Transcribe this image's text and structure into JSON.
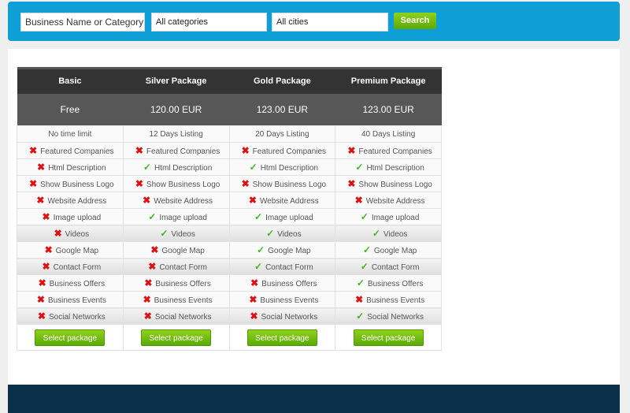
{
  "search": {
    "query_placeholder": "Business Name or Category",
    "category": "All categories",
    "city": "All cities",
    "button": "Search"
  },
  "packages": [
    {
      "name": "Basic",
      "price": "Free",
      "duration": "No time limit",
      "features": [
        false,
        false,
        false,
        false,
        false,
        false,
        false,
        false,
        false,
        false,
        false
      ]
    },
    {
      "name": "Silver Package",
      "price": "120.00 EUR",
      "duration": "12 Days Listing",
      "features": [
        false,
        true,
        false,
        false,
        true,
        true,
        false,
        false,
        false,
        false,
        false
      ]
    },
    {
      "name": "Gold Package",
      "price": "123.00 EUR",
      "duration": "20 Days Listing",
      "features": [
        false,
        true,
        false,
        false,
        true,
        true,
        true,
        true,
        false,
        false,
        false
      ]
    },
    {
      "name": "Premium Package",
      "price": "123.00 EUR",
      "duration": "40 Days Listing",
      "features": [
        false,
        true,
        false,
        false,
        true,
        true,
        true,
        true,
        true,
        false,
        true
      ]
    }
  ],
  "feature_names": [
    "Featured Companies",
    "Html Description",
    "Show Business Logo",
    "Website Address",
    "Image upload",
    "Videos",
    "Google Map",
    "Contact Form",
    "Business Offers",
    "Business Events",
    "Social Networks"
  ],
  "select_label": "Select package",
  "icons": {
    "yes": "check-icon",
    "no": "cross-icon"
  }
}
